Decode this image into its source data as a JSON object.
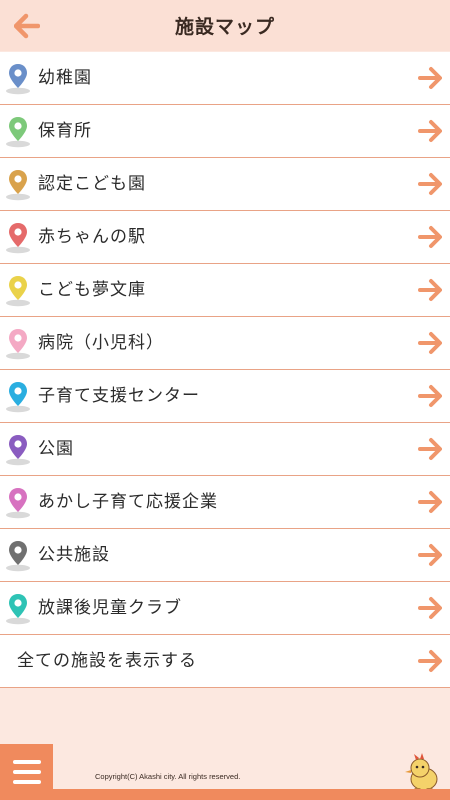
{
  "header": {
    "title": "施設マップ"
  },
  "items": [
    {
      "label": "幼稚園",
      "color": "#6a8fc9",
      "icon": "map-pin-icon"
    },
    {
      "label": "保育所",
      "color": "#7dc97a",
      "icon": "map-pin-icon"
    },
    {
      "label": "認定こども園",
      "color": "#d9a24c",
      "icon": "map-pin-icon"
    },
    {
      "label": "赤ちゃんの駅",
      "color": "#e56a6a",
      "icon": "map-pin-icon"
    },
    {
      "label": "こども夢文庫",
      "color": "#ead24a",
      "icon": "map-pin-icon"
    },
    {
      "label": "病院（小児科）",
      "color": "#f4a9c4",
      "icon": "map-pin-icon"
    },
    {
      "label": "子育て支援センター",
      "color": "#2aaee0",
      "icon": "map-pin-icon"
    },
    {
      "label": "公園",
      "color": "#8a5cc0",
      "icon": "map-pin-icon"
    },
    {
      "label": "あかし子育て応援企業",
      "color": "#d772c0",
      "icon": "map-pin-icon"
    },
    {
      "label": "公共施設",
      "color": "#707070",
      "icon": "map-pin-icon"
    },
    {
      "label": "放課後児童クラブ",
      "color": "#2ec3b5",
      "icon": "map-pin-icon"
    }
  ],
  "all_facilities": {
    "label": "全ての施設を表示する"
  },
  "footer": {
    "copyright": "Copyright(C) Akashi city. All rights reserved."
  },
  "colors": {
    "accent": "#f08a5d",
    "arrow": "#f0966b",
    "header_bg": "#fbe0d5",
    "divider": "#e9a386"
  }
}
